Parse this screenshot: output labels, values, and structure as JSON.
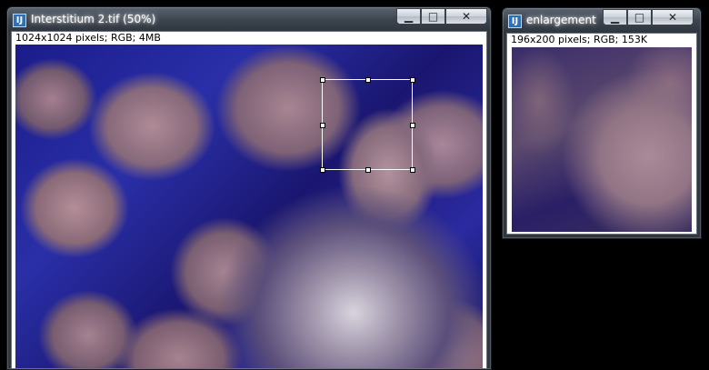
{
  "main_window": {
    "title": "Interstitium 2.tif (50%)",
    "info": "1024x1024 pixels; RGB; 4MB",
    "icon": "imagej-icon",
    "buttons": {
      "minimize": "▁",
      "maximize": "□",
      "close": "✕"
    }
  },
  "enlargement_window": {
    "title": "enlargement",
    "info": "196x200 pixels; RGB; 153K",
    "icon": "imagej-icon",
    "buttons": {
      "minimize": "▁",
      "maximize": "□",
      "close": "✕"
    }
  }
}
